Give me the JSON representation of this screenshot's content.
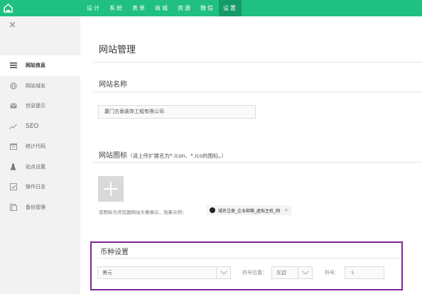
{
  "topnav": {
    "items": [
      "设计",
      "系统",
      "表单",
      "商城",
      "资源",
      "微信",
      "设置"
    ],
    "active_index": 6
  },
  "sidebar": {
    "close_glyph": "×",
    "items": [
      {
        "label": "网站信息",
        "icon": "list-icon",
        "active": true
      },
      {
        "label": "网站域名",
        "icon": "globe-icon"
      },
      {
        "label": "信息提示",
        "icon": "message-icon"
      },
      {
        "label": "SEO",
        "icon": "trend-icon"
      },
      {
        "label": "统计代码",
        "icon": "calendar-icon"
      },
      {
        "label": "站点设置",
        "icon": "flask-icon"
      },
      {
        "label": "操作日志",
        "icon": "checkbox-icon"
      },
      {
        "label": "备份管理",
        "icon": "database-icon"
      }
    ]
  },
  "main": {
    "page_title": "网站管理",
    "site_name": {
      "label": "网站名称",
      "value": "厦门古香装饰工程有限公司"
    },
    "favicon": {
      "label": "网站图标",
      "hint": "（请上传扩展名为*.icon、*.ico的图标。）",
      "desc": "该图标为浏览器网站头像展示，效果示例：",
      "demo_text": "域名注册_企业邮箱_虚拟主机_网",
      "demo_close": "×"
    },
    "currency": {
      "title": "币种设置",
      "currency_value": "美元",
      "position_label": "符号位置：",
      "position_value": "左边",
      "symbol_label": "符号：",
      "symbol_value": "$"
    }
  },
  "colors": {
    "topbar": "#20bf82",
    "topbar_active": "#149b68",
    "highlight_border": "#7b2891"
  }
}
